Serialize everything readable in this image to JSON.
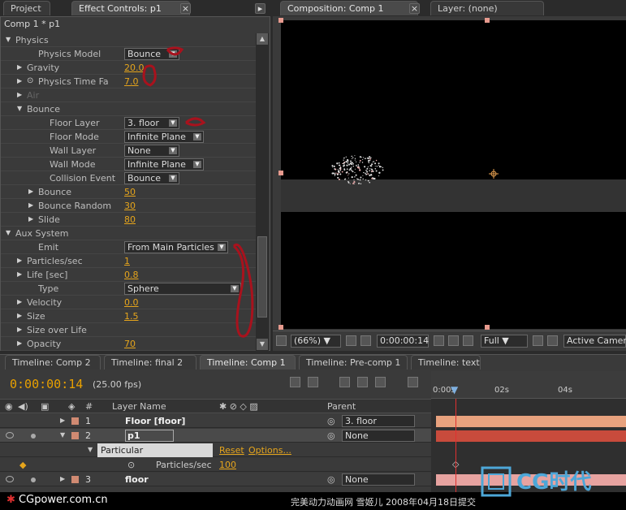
{
  "panels": {
    "project_tab": "Project",
    "effect_controls_tab": "Effect Controls: p1",
    "composition_tab": "Composition: Comp 1",
    "layer_tab": "Layer: (none)"
  },
  "effect_controls": {
    "breadcrumb": "Comp 1 * p1",
    "rows": [
      {
        "label": "Physics",
        "indent": 0,
        "tri": "▼"
      },
      {
        "label": "Physics Model",
        "indent": 2,
        "dropdown": "Bounce"
      },
      {
        "label": "Gravity",
        "indent": 1,
        "tri": "▶",
        "value": "20.0"
      },
      {
        "label": "Physics Time Fa",
        "indent": 1,
        "tri": "▶",
        "stopwatch": true,
        "value": "7.0"
      },
      {
        "label": "Air",
        "indent": 1,
        "tri": "▶",
        "dim": true
      },
      {
        "label": "Bounce",
        "indent": 1,
        "tri": "▼"
      },
      {
        "label": "Floor Layer",
        "indent": 3,
        "dropdown": "3. floor"
      },
      {
        "label": "Floor Mode",
        "indent": 3,
        "dropdown": "Infinite Plane"
      },
      {
        "label": "Wall Layer",
        "indent": 3,
        "dropdown": "None"
      },
      {
        "label": "Wall Mode",
        "indent": 3,
        "dropdown": "Infinite Plane"
      },
      {
        "label": "Collision Event",
        "indent": 3,
        "dropdown": "Bounce"
      },
      {
        "label": "Bounce",
        "indent": 2,
        "tri": "▶",
        "value": "50"
      },
      {
        "label": "Bounce Random",
        "indent": 2,
        "tri": "▶",
        "value": "30"
      },
      {
        "label": "Slide",
        "indent": 2,
        "tri": "▶",
        "value": "80"
      },
      {
        "label": "Aux System",
        "indent": 0,
        "tri": "▼"
      },
      {
        "label": "Emit",
        "indent": 2,
        "dropdown": "From Main Particles"
      },
      {
        "label": "Particles/sec",
        "indent": 1,
        "tri": "▶",
        "value": "1"
      },
      {
        "label": "Life [sec]",
        "indent": 1,
        "tri": "▶",
        "value": "0.8"
      },
      {
        "label": "Type",
        "indent": 2,
        "dropdown": "Sphere"
      },
      {
        "label": "Velocity",
        "indent": 1,
        "tri": "▶",
        "value": "0.0"
      },
      {
        "label": "Size",
        "indent": 1,
        "tri": "▶",
        "value": "1.5"
      },
      {
        "label": "Size over Life",
        "indent": 1,
        "tri": "▶"
      },
      {
        "label": "Opacity",
        "indent": 1,
        "tri": "▶",
        "value": "70"
      }
    ]
  },
  "composition": {
    "zoom": "(66%)",
    "timecode": "0:00:00:14",
    "resolution": "Full",
    "camera": "Active Camera"
  },
  "timeline": {
    "tabs": [
      "Timeline: Comp 2",
      "Timeline: final 2",
      "Timeline: Comp 1",
      "Timeline: Pre-comp 1",
      "Timeline: text"
    ],
    "active_tab": "Timeline: Comp 1",
    "current_time": "0:00:00:14",
    "fps": "(25.00 fps)",
    "header": {
      "num": "#",
      "layer_name": "Layer Name",
      "parent": "Parent"
    },
    "ruler": [
      "0:00s",
      "02s",
      "04s"
    ],
    "layers": [
      {
        "num": "1",
        "name": "Floor [floor]",
        "color": "#d08a72",
        "parent": "3. floor"
      },
      {
        "num": "2",
        "name": "p1",
        "color": "#d08a72",
        "parent": "None",
        "selected": true
      },
      {
        "num": "3",
        "name": "floor",
        "color": "#d08a72",
        "parent": "None"
      }
    ],
    "effect_name": "Particular",
    "reset_label": "Reset",
    "options_label": "Options...",
    "property_label": "Particles/sec",
    "property_value": "100"
  },
  "footer": {
    "site": "CGpower.com.cn",
    "credit": "完美动力动画网 雪姬儿 2008年04月18日提交",
    "logo_text": "CG时代"
  },
  "colors": {
    "accent": "#e6a51c",
    "timecode": "#e8a000",
    "bar_orange": "#e8a27e",
    "bar_red": "#c84b3c",
    "bar_pink": "#e7a3a0"
  }
}
